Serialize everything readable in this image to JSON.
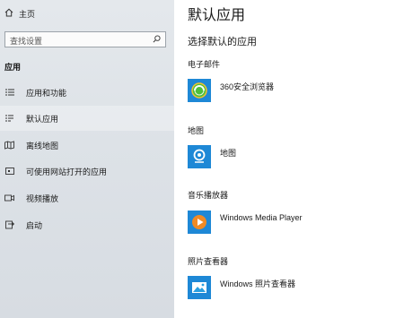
{
  "sidebar": {
    "home_label": "主页",
    "search_placeholder": "查找设置",
    "section_title": "应用",
    "items": [
      {
        "label": "应用和功能",
        "icon": "list-icon",
        "selected": false
      },
      {
        "label": "默认应用",
        "icon": "default-apps-icon",
        "selected": true
      },
      {
        "label": "离线地图",
        "icon": "map-icon",
        "selected": false
      },
      {
        "label": "可使用网站打开的应用",
        "icon": "website-apps-icon",
        "selected": false
      },
      {
        "label": "视频播放",
        "icon": "video-icon",
        "selected": false
      },
      {
        "label": "启动",
        "icon": "startup-icon",
        "selected": false
      }
    ]
  },
  "main": {
    "title": "默认应用",
    "subtitle": "选择默认的应用",
    "categories": [
      {
        "label": "电子邮件",
        "app": "360安全浏览器",
        "icon": "360-browser-icon"
      },
      {
        "label": "地图",
        "app": "地图",
        "icon": "maps-app-icon"
      },
      {
        "label": "音乐播放器",
        "app": "Windows Media Player",
        "icon": "media-player-icon"
      },
      {
        "label": "照片查看器",
        "app": "Windows 照片查看器",
        "icon": "photo-viewer-icon"
      }
    ]
  },
  "colors": {
    "sidebar_bg": "#dde2e7",
    "tile_blue": "#1e88d6",
    "selected_highlight": "#e9ecef"
  }
}
